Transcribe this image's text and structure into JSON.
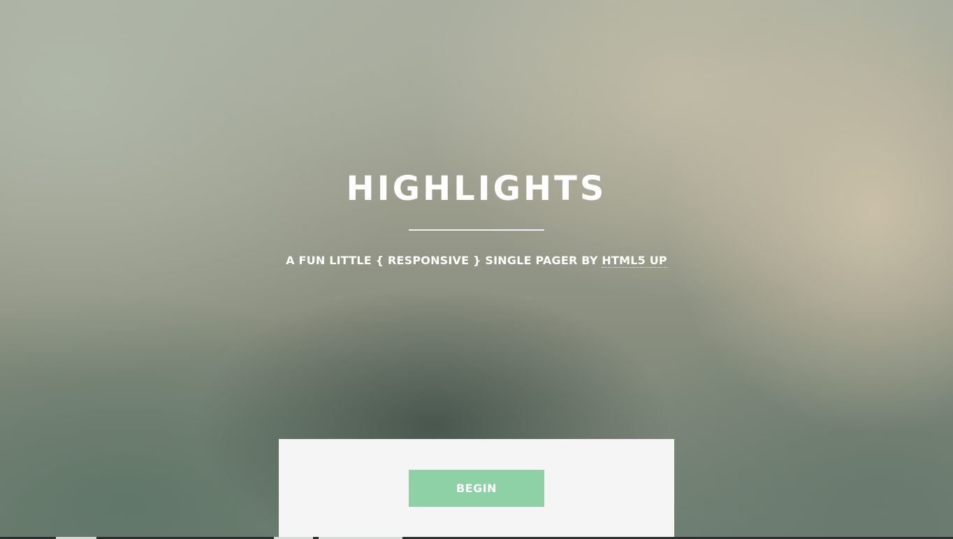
{
  "header": {
    "title": "HIGHLIGHTS",
    "tagline_prefix": "A FUN LITTLE { RESPONSIVE } SINGLE PAGER BY ",
    "tagline_link": "HTML5 UP"
  },
  "intro": {
    "button_label": "BEGIN"
  },
  "colors": {
    "accent": "#8fd1a6",
    "panel_background": "#f5f5f5",
    "text": "#ffffff"
  }
}
